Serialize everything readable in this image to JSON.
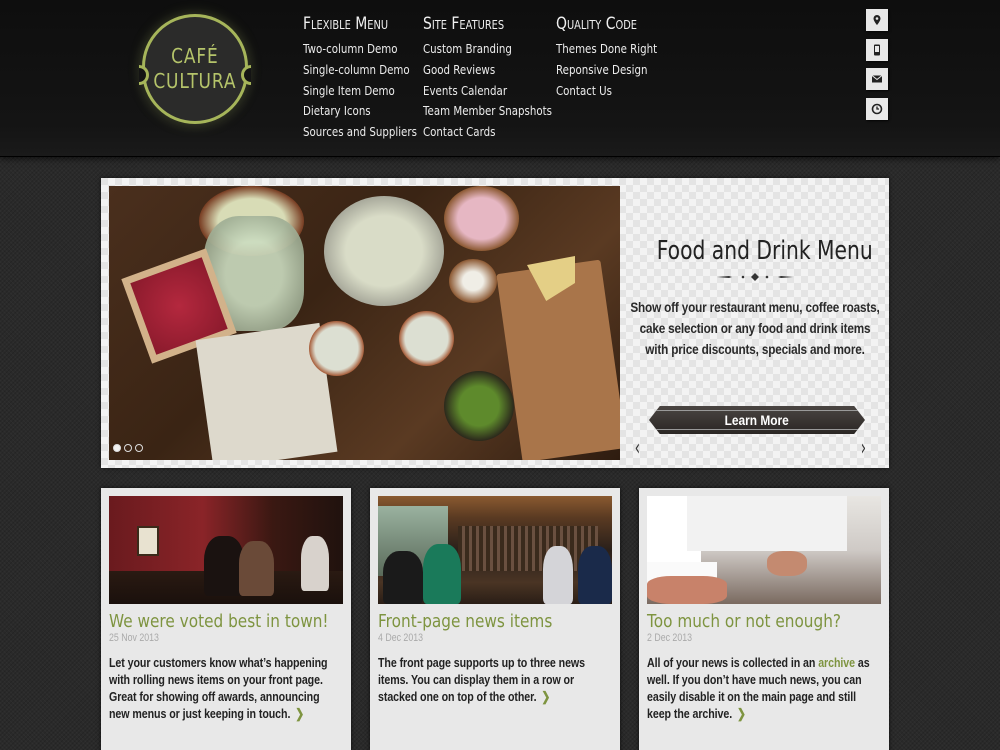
{
  "logo": {
    "line1": "CAFÉ",
    "line2": "CULTURA"
  },
  "nav": [
    {
      "title": "Flexible Menu",
      "items": [
        "Two-column Demo",
        "Single-column Demo",
        "Single Item Demo",
        "Dietary Icons",
        "Sources and Suppliers"
      ]
    },
    {
      "title": "Site Features",
      "items": [
        "Custom Branding",
        "Good Reviews",
        "Events Calendar",
        "Team Member Snapshots",
        "Contact Cards"
      ]
    },
    {
      "title": "Quality Code",
      "items": [
        "Themes Done Right",
        "Reponsive Design",
        "Contact Us"
      ]
    }
  ],
  "header_icons": [
    "map-pin-icon",
    "phone-icon",
    "envelope-icon",
    "clock-icon"
  ],
  "slider": {
    "title": "Food and Drink Menu",
    "text": "Show off your restaurant menu, coffee roasts, cake selection or any food and drink items with price discounts, specials and more.",
    "button": "Learn More",
    "prev": "‹",
    "next": "›",
    "slide_count": 3,
    "active_slide": 1
  },
  "news": [
    {
      "title": "We were voted best in town!",
      "date": "25 Nov 2013",
      "text": "Let your customers know what’s happening with rolling news items on your front page. Great for showing off awards, announcing new menus or just keeping in touch."
    },
    {
      "title": "Front-page news items",
      "date": "4 Dec 2013",
      "text": "The front page supports up to three news items. You can display them in a row or stacked one on top of the other."
    },
    {
      "title": "Too much or not enough?",
      "date": "2 Dec 2013",
      "text_before": "All of your news is collected in an ",
      "link": "archive",
      "text_after": " as well. If you don’t have much news, you can easily disable it on the main page and still keep the archive."
    }
  ],
  "colors": {
    "accent": "#7e9440",
    "logo": "#a6b55a",
    "header_bg": "#111111",
    "page_bg": "#2a2a2a"
  }
}
